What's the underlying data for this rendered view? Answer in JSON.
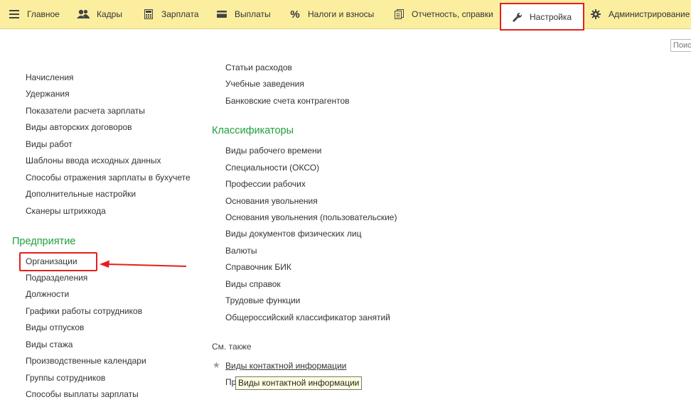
{
  "nav": {
    "items": [
      {
        "label": "Главное",
        "icon": "menu-icon"
      },
      {
        "label": "Кадры",
        "icon": "people-icon"
      },
      {
        "label": "Зарплата",
        "icon": "calculator-icon"
      },
      {
        "label": "Выплаты",
        "icon": "card-icon"
      },
      {
        "label": "Налоги и взносы",
        "icon": "percent-icon"
      },
      {
        "label": "Отчетность, справки",
        "icon": "reports-icon"
      },
      {
        "label": "Настройка",
        "icon": "wrench-icon",
        "active": true
      },
      {
        "label": "Администрирование",
        "icon": "gear-icon"
      }
    ]
  },
  "search": {
    "placeholder": "Поиск"
  },
  "left_column": {
    "links": [
      "Начисления",
      "Удержания",
      "Показатели расчета зарплаты",
      "Виды авторских договоров",
      "Виды работ",
      "Шаблоны ввода исходных данных",
      "Способы отражения зарплаты в бухучете",
      "Дополнительные настройки",
      "Сканеры штрихкода"
    ],
    "section_title": "Предприятие",
    "enterprise_links": [
      "Организации",
      "Подразделения",
      "Должности",
      "Графики работы сотрудников",
      "Виды отпусков",
      "Виды стажа",
      "Производственные календари",
      "Группы сотрудников",
      "Способы выплаты зарплаты"
    ]
  },
  "right_column": {
    "links": [
      "Статьи расходов",
      "Учебные заведения",
      "Банковские счета контрагентов"
    ],
    "section_title": "Классификаторы",
    "classifier_links": [
      "Виды рабочего времени",
      "Специальности (ОКСО)",
      "Профессии рабочих",
      "Основания увольнения",
      "Основания увольнения (пользовательские)",
      "Виды документов физических лиц",
      "Валюты",
      "Справочник БИК",
      "Виды справок",
      "Трудовые функции",
      "Общероссийский классификатор занятий"
    ],
    "see_also_title": "См. также",
    "see_also_links": [
      "Виды контактной информации",
      "Пр"
    ],
    "tooltip": "Виды контактной информации"
  },
  "colors": {
    "nav_background": "#fbee9f",
    "section_title": "#1f9f3c",
    "annotation_red": "#e81e1e"
  }
}
